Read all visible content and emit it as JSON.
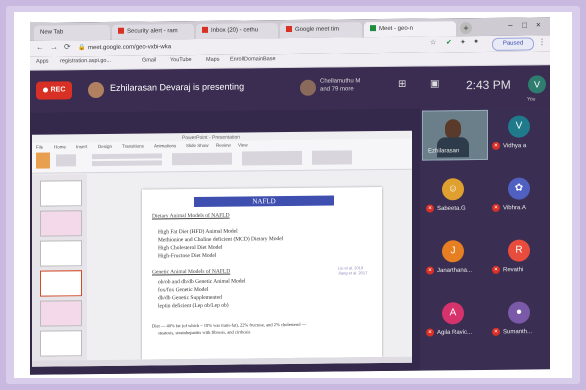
{
  "browser": {
    "tabs": [
      {
        "label": "New Tab",
        "active": false
      },
      {
        "label": "Security alert - ram",
        "active": false
      },
      {
        "label": "Inbox (20) - cethu",
        "active": false
      },
      {
        "label": "Google meet tim",
        "active": false
      },
      {
        "label": "Meet - geo-n",
        "active": true
      }
    ],
    "new_tab_label": "+",
    "url": "meet.google.com/geo-vxbi-wka",
    "profile_label": "Paused",
    "bookmarks": [
      "Apps",
      "registration.aspi.go...",
      "Gmail",
      "YouTube",
      "Maps",
      "EnrollDomainBase"
    ]
  },
  "meet": {
    "rec_label": "REC",
    "presenter_text": "Ezhilarasan Devaraj is presenting",
    "others_line1": "Chellamuthu M",
    "others_line2": "and 79 more",
    "time": "2:43 PM",
    "self_initial": "V",
    "self_label": "You"
  },
  "presentation": {
    "window_title": "PowerPoint - Presentation",
    "ribbon_tabs": [
      "File",
      "Home",
      "Insert",
      "Design",
      "Transitions",
      "Animations",
      "Slide Show",
      "Review",
      "View"
    ],
    "slide": {
      "heading": "NAFLD",
      "section1": "Dietary Animal Models of NAFLD",
      "bullets1": [
        "High Fat Diet (HFD) Animal Model",
        "Methionine and Choline deficient (MCD) Dietary Model",
        "High Cholesterol Diet Model",
        "High-Fructose Diet Model"
      ],
      "section2": "Genetic Animal Models of NAFLD",
      "bullets2": [
        "ob/ob and db/db Genetic Animal Model",
        "fox/fox Genetic Model",
        "db/db Genetic Supplemented",
        "leptin deficient (Lep ob/Lep ob)"
      ],
      "note_line1": "Liu et al. 2019",
      "note_line2": "Jiang et al. 2017",
      "footer_line1": "Diet — 40% fat (of which ~ 18% was trans-fat), 22% fructose, and 2% cholesterol —",
      "footer_line2": "steatosis, steatohepatitis with fibrosis, and cirrhosis"
    }
  },
  "participants": [
    {
      "name": "Ezhilarasan",
      "initial": "",
      "color": "#6a7f8a",
      "camera": true
    },
    {
      "name": "Vidhya a",
      "initial": "V",
      "color": "#1f7a8c",
      "camera": false
    },
    {
      "name": "Sabeeta.G",
      "initial": "",
      "color": "#e0a030",
      "camera": false
    },
    {
      "name": "Vibhra.A",
      "initial": "",
      "color": "#5060c0",
      "camera": false
    },
    {
      "name": "Janarthana...",
      "initial": "J",
      "color": "#e67e22",
      "camera": false
    },
    {
      "name": "Revathi",
      "initial": "R",
      "color": "#e74c3c",
      "camera": false
    },
    {
      "name": "Agila Ravic...",
      "initial": "A",
      "color": "#d6336c",
      "camera": false
    },
    {
      "name": "Sumanth...",
      "initial": "",
      "color": "#7a5aa8",
      "camera": false
    }
  ]
}
